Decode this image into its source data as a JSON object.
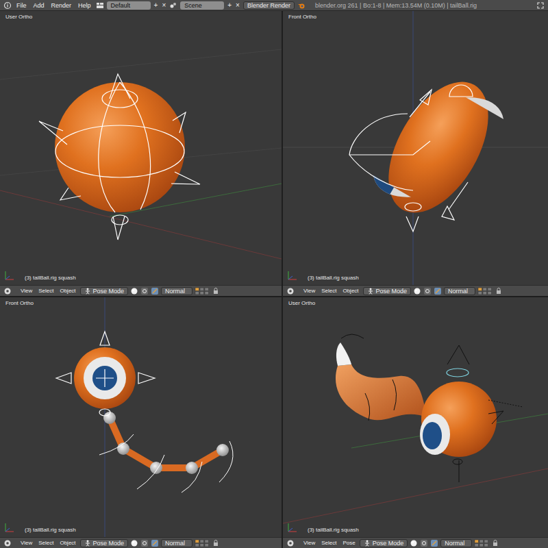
{
  "topbar": {
    "menus": [
      "File",
      "Add",
      "Render",
      "Help"
    ],
    "screen": {
      "name": "Default",
      "add": "+",
      "remove": "×"
    },
    "scene": {
      "name": "Scene",
      "add": "+",
      "remove": "×"
    },
    "engine": "Blender Render",
    "info": "blender.org 261 | Bo:1-8 | Mem:13.54M (0.10M) | tailBall.rig"
  },
  "viewports": [
    {
      "kind": "rig-sphere",
      "title": "User Ortho",
      "status": "(3) tailBall.rig squash",
      "menus": [
        "View",
        "Select",
        "Object"
      ],
      "mode": "Pose Mode",
      "orientation": "Normal"
    },
    {
      "kind": "rig-squash",
      "title": "Front Ortho",
      "status": "(3) tailBall.rig squash",
      "menus": [
        "View",
        "Select",
        "Object"
      ],
      "mode": "Pose Mode",
      "orientation": "Normal"
    },
    {
      "kind": "eye-chain",
      "title": "Front Ortho",
      "status": "(3) tailBall.rig squash",
      "menus": [
        "View",
        "Select",
        "Object"
      ],
      "mode": "Pose Mode",
      "orientation": "Normal"
    },
    {
      "kind": "eye-tail",
      "title": "User Ortho",
      "status": "(3) tailBall.rig squash",
      "menus": [
        "View",
        "Select",
        "Pose"
      ],
      "mode": "Pose Mode",
      "orientation": "Normal"
    }
  ]
}
